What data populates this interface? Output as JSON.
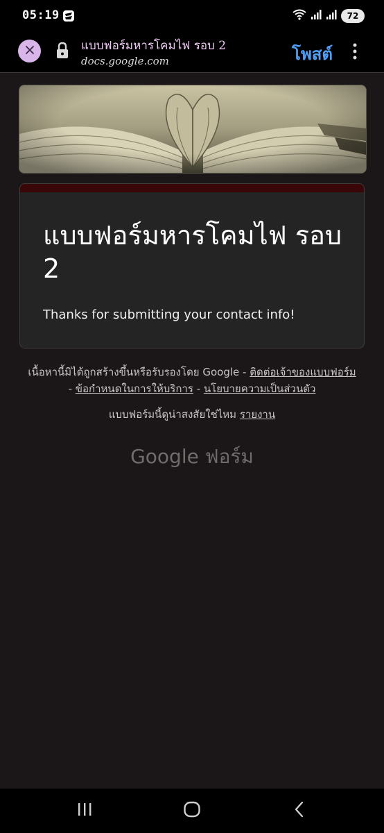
{
  "status_bar": {
    "time": "05:19",
    "battery": "72"
  },
  "tab": {
    "title": "แบบฟอร์มหารโคมไฟ รอบ 2",
    "url": "docs.google.com",
    "post_label": "โพสต์"
  },
  "form": {
    "title": "แบบฟอร์มหารโคมไฟ รอบ 2",
    "confirmation": "Thanks for submitting your contact info!",
    "accent_color": "#3a0607"
  },
  "footer": {
    "disclaimer_prefix": "เนื้อหานี้มิได้ถูกสร้างขึ้นหรือรับรองโดย Google - ",
    "contact_owner": "ติดต่อเจ้าของแบบฟอร์ม",
    "sep1": " - ",
    "terms": "ข้อกำหนดในการให้บริการ",
    "sep2": " - ",
    "privacy": "นโยบายความเป็นส่วนตัว",
    "suspicious_prefix": "แบบฟอร์มนี้ดูน่าสงสัยใช่ไหม ",
    "report": "รายงาน",
    "brand_google": "Google",
    "brand_forms": "ฟอร์ม"
  },
  "colors": {
    "background": "#1b1718",
    "card": "#242424",
    "post_button": "#4f9ef5",
    "close_button": "#d8b6ea"
  },
  "icons": {
    "close": "close-icon",
    "lock": "lock-icon",
    "more": "more-vert-icon",
    "recents": "recents-icon",
    "home": "home-icon",
    "back": "back-icon"
  }
}
